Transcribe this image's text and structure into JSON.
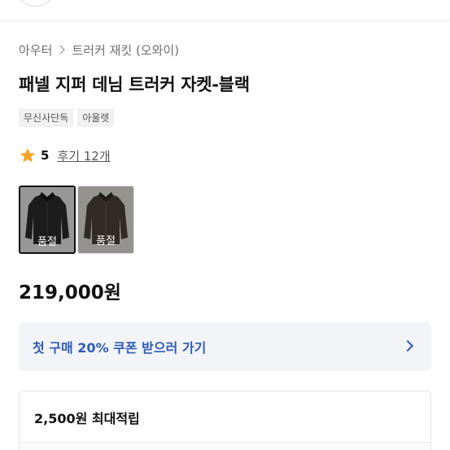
{
  "breadcrumb": {
    "items": [
      "아우터",
      "트러커 재킷 (오와이)"
    ]
  },
  "product": {
    "title": "패넬 지퍼 데님 트러커 자켓-블랙",
    "tags": [
      "무신사단독",
      "아울렛"
    ],
    "rating": {
      "score": "5",
      "reviews_label": "후기 12개"
    },
    "thumbnails": [
      {
        "status": "품절",
        "selected": true
      },
      {
        "status": "품절",
        "selected": false
      }
    ],
    "price": "219,000원"
  },
  "coupon": {
    "label": "첫 구매 20% 쿠폰 받으러 가기"
  },
  "points": {
    "label": "2,500원 최대적립"
  },
  "colors": {
    "accent_blue": "#2f5ab8",
    "star": "#f5a623"
  },
  "icons": [
    "chevron-right-icon",
    "star-icon",
    "chevron-right-icon"
  ]
}
